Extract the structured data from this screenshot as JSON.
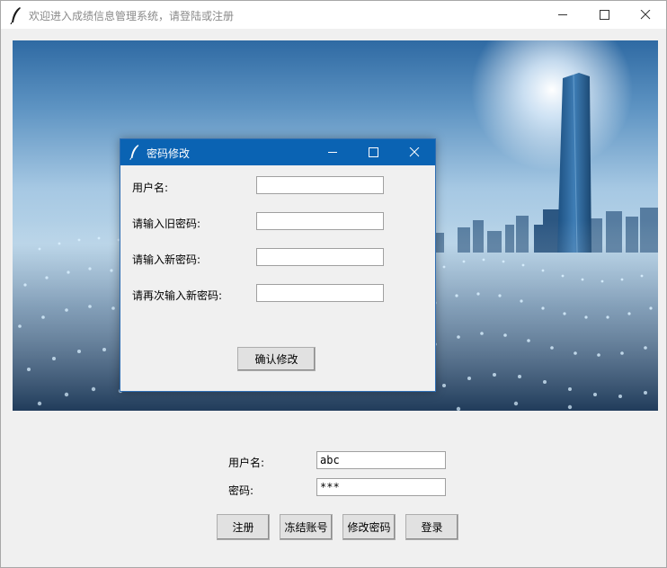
{
  "window": {
    "title": "欢迎进入成绩信息管理系统，请登陆或注册"
  },
  "dialog": {
    "title": "密码修改",
    "labels": {
      "username": "用户名:",
      "old_password": "请输入旧密码:",
      "new_password": "请输入新密码:",
      "confirm_password": "请再次输入新密码:"
    },
    "values": {
      "username": "",
      "old_password": "",
      "new_password": "",
      "confirm_password": ""
    },
    "confirm_button": "确认修改"
  },
  "login": {
    "username_label": "用户名:",
    "username_value": "abc",
    "password_label": "密码:",
    "password_value": "***",
    "buttons": {
      "register": "注册",
      "freeze": "冻结账号",
      "change_password": "修改密码",
      "login": "登录"
    }
  },
  "colors": {
    "dialog_titlebar": "#0a63b3",
    "window_bg": "#f0f0f0"
  },
  "icons": [
    "feather-icon",
    "minimize-icon",
    "maximize-icon",
    "close-icon"
  ]
}
